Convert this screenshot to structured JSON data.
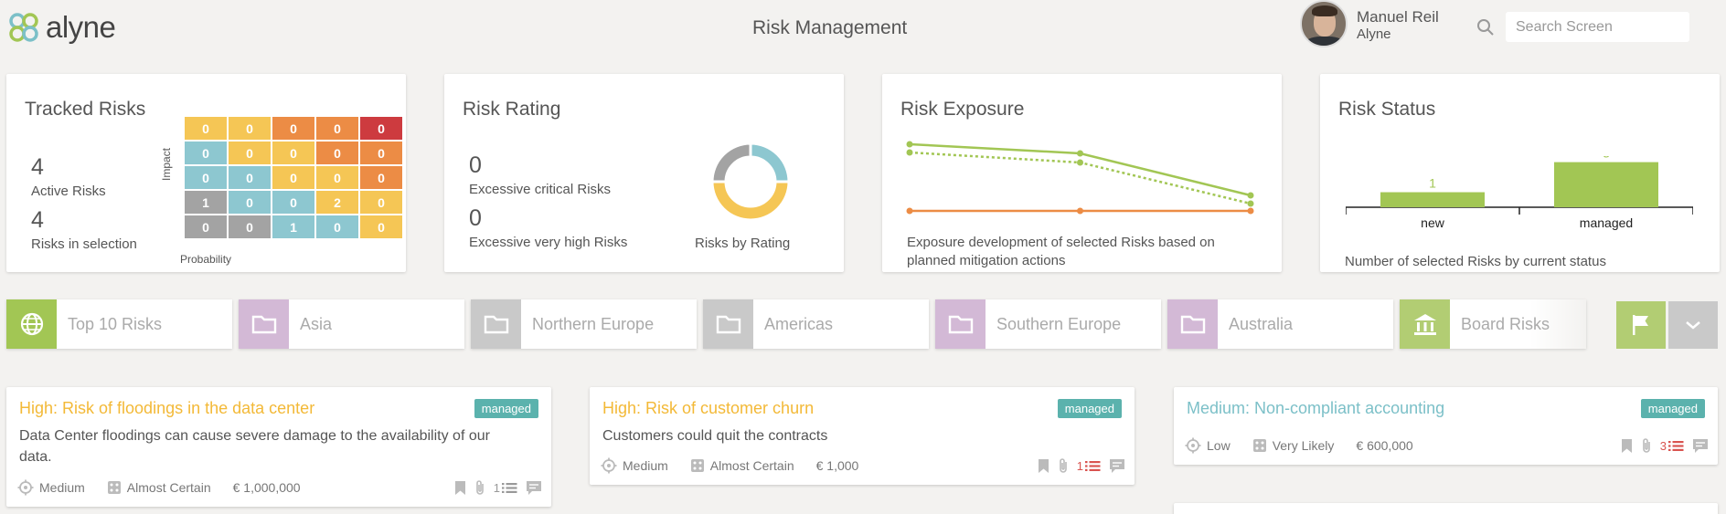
{
  "app": {
    "logo_text": "alyne",
    "title": "Risk Management"
  },
  "user": {
    "name": "Manuel Reil",
    "org": "Alyne"
  },
  "search": {
    "placeholder": "Search Screen"
  },
  "colors": {
    "yellow": "#f5c655",
    "orange": "#ec8c45",
    "red": "#cd3b3f",
    "teal": "#8dc7d0",
    "gray": "#a3a3a3",
    "green": "#a2c654",
    "badge": "#5bb2ad"
  },
  "tracked": {
    "title": "Tracked Risks",
    "active_count": "4",
    "active_label": "Active Risks",
    "selection_count": "4",
    "selection_label": "Risks in selection",
    "impact_label": "Impact",
    "probability_label": "Probability",
    "matrix": [
      [
        {
          "v": "0",
          "c": "yellow"
        },
        {
          "v": "0",
          "c": "yellow"
        },
        {
          "v": "0",
          "c": "orange"
        },
        {
          "v": "0",
          "c": "orange"
        },
        {
          "v": "0",
          "c": "red"
        }
      ],
      [
        {
          "v": "0",
          "c": "teal"
        },
        {
          "v": "0",
          "c": "yellow"
        },
        {
          "v": "0",
          "c": "yellow"
        },
        {
          "v": "0",
          "c": "orange"
        },
        {
          "v": "0",
          "c": "orange"
        }
      ],
      [
        {
          "v": "0",
          "c": "teal"
        },
        {
          "v": "0",
          "c": "teal"
        },
        {
          "v": "0",
          "c": "yellow"
        },
        {
          "v": "0",
          "c": "yellow"
        },
        {
          "v": "0",
          "c": "orange"
        }
      ],
      [
        {
          "v": "1",
          "c": "gray"
        },
        {
          "v": "0",
          "c": "teal"
        },
        {
          "v": "0",
          "c": "teal"
        },
        {
          "v": "2",
          "c": "yellow"
        },
        {
          "v": "0",
          "c": "yellow"
        }
      ],
      [
        {
          "v": "0",
          "c": "gray"
        },
        {
          "v": "0",
          "c": "gray"
        },
        {
          "v": "1",
          "c": "teal"
        },
        {
          "v": "0",
          "c": "teal"
        },
        {
          "v": "0",
          "c": "yellow"
        }
      ]
    ]
  },
  "rating": {
    "title": "Risk Rating",
    "critical_count": "0",
    "critical_label": "Excessive critical Risks",
    "veryhigh_count": "0",
    "veryhigh_label": "Excessive very high Risks",
    "donut_label": "Risks by Rating"
  },
  "exposure": {
    "title": "Risk Exposure",
    "caption_line1": "Exposure development of selected Risks based on",
    "caption_line2": "planned mitigation actions"
  },
  "status": {
    "title": "Risk Status",
    "caption": "Number of selected Risks by current status"
  },
  "chart_data": [
    {
      "type": "pie",
      "title": "Risks by Rating",
      "series": [
        {
          "color": "#8dc7d0",
          "value": 1
        },
        {
          "color": "#f5c655",
          "value": 2
        },
        {
          "color": "#a3a3a3",
          "value": 1
        }
      ]
    },
    {
      "type": "line",
      "x": [
        1,
        2,
        3
      ],
      "ylim": [
        0,
        1
      ],
      "series": [
        {
          "color": "#a2c654",
          "style": "solid",
          "values": [
            0.93,
            0.83,
            0.37
          ]
        },
        {
          "color": "#a2c654",
          "style": "dotted",
          "values": [
            0.84,
            0.73,
            0.28
          ]
        },
        {
          "color": "#ec8c45",
          "style": "solid",
          "values": [
            0.2,
            0.2,
            0.2
          ]
        }
      ],
      "grid": false
    },
    {
      "type": "bar",
      "categories": [
        "new",
        "managed"
      ],
      "values": [
        1,
        3
      ],
      "ylim": [
        0,
        3.4
      ],
      "color": "#a2c654"
    }
  ],
  "folders": [
    {
      "label": "Top 10 Risks",
      "icon": "globe-icon",
      "color": "#a2c654"
    },
    {
      "label": "Asia",
      "icon": "folder-icon",
      "color": "#d3b9d6"
    },
    {
      "label": "Northern Europe",
      "icon": "folder-icon",
      "color": "#c9c9c9"
    },
    {
      "label": "Americas",
      "icon": "folder-icon",
      "color": "#c9c9c9"
    },
    {
      "label": "Southern Europe",
      "icon": "folder-icon",
      "color": "#d3b9d6"
    },
    {
      "label": "Australia",
      "icon": "folder-icon",
      "color": "#d3b9d6"
    },
    {
      "label": "Board Risks",
      "icon": "bank-icon",
      "color": "#b2cd73"
    }
  ],
  "risks": [
    {
      "title": "High: Risk of floodings in the data center",
      "title_color": "#f3b937",
      "status": "managed",
      "desc1": "Data Center floodings can cause severe damage to the availability of our",
      "desc2": "data.",
      "impact": "Medium",
      "probability": "Almost Certain",
      "value": "€ 1,000,000",
      "task_count": "1",
      "task_color": "#999999"
    },
    {
      "title": "High: Risk of customer churn",
      "title_color": "#f3b937",
      "status": "managed",
      "desc1": "Customers could quit the contracts",
      "desc2": "",
      "impact": "Medium",
      "probability": "Almost Certain",
      "value": "€ 1,000",
      "task_count": "1",
      "task_color": "#d9534f"
    },
    {
      "title": "Medium: Non-compliant accounting",
      "title_color": "#7cc0c8",
      "status": "managed",
      "desc1": "",
      "desc2": "",
      "impact": "Low",
      "probability": "Very Likely",
      "value": "€ 600,000",
      "task_count": "3",
      "task_color": "#d9534f"
    }
  ]
}
